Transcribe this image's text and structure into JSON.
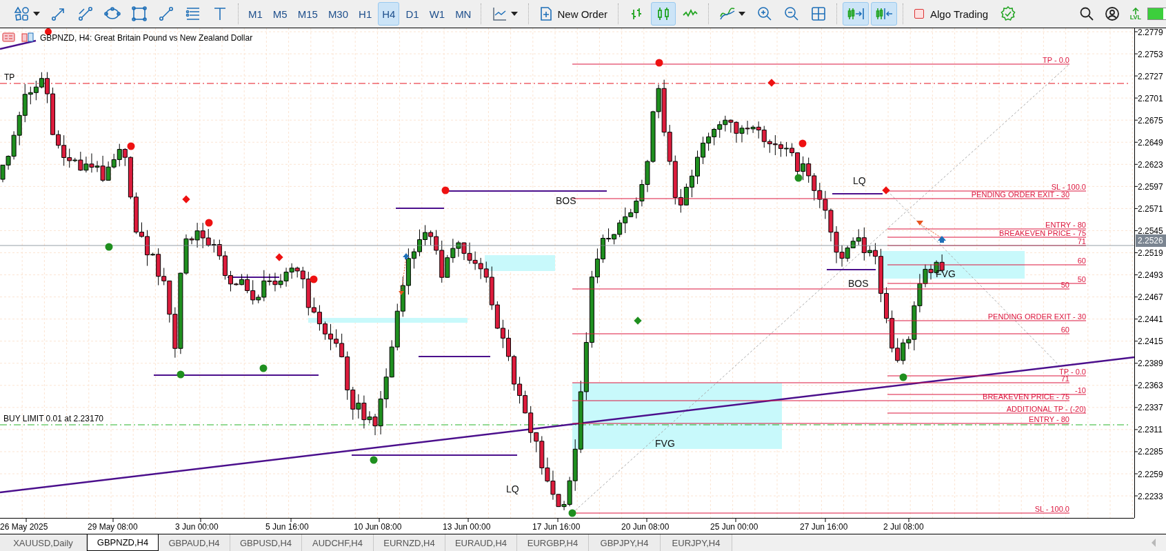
{
  "toolbar": {
    "tools": [
      {
        "kind": "shapes"
      },
      {
        "kind": "arrow"
      },
      {
        "kind": "segment"
      },
      {
        "kind": "ellipse"
      },
      {
        "kind": "rectangle"
      },
      {
        "kind": "line"
      },
      {
        "kind": "fibo"
      },
      {
        "kind": "text"
      }
    ],
    "timeframes": [
      {
        "label": "M1",
        "selected": false
      },
      {
        "label": "M5",
        "selected": false
      },
      {
        "label": "M15",
        "selected": false
      },
      {
        "label": "M30",
        "selected": false
      },
      {
        "label": "H1",
        "selected": false
      },
      {
        "label": "H4",
        "selected": true
      },
      {
        "label": "D1",
        "selected": false
      },
      {
        "label": "W1",
        "selected": false
      },
      {
        "label": "MN",
        "selected": false
      }
    ],
    "new_order": "New Order",
    "chart_styles": [
      {
        "kind": "bars",
        "selected": false
      },
      {
        "kind": "candles",
        "selected": true
      },
      {
        "kind": "line",
        "selected": false
      }
    ],
    "view_tools": [
      {
        "kind": "indicators"
      },
      {
        "kind": "zoom-in"
      },
      {
        "kind": "zoom-out"
      },
      {
        "kind": "tile"
      }
    ],
    "scroll_tools": [
      {
        "kind": "autoscroll",
        "selected": true
      },
      {
        "kind": "shift",
        "selected": true
      }
    ],
    "algo_trading": {
      "label": "Algo Trading",
      "on": false
    },
    "level_label": "LVL"
  },
  "chart": {
    "title": "GBPNZD, H4:  Great Britain Pound vs New Zealand Dollar",
    "price_ticks": [
      "2.2779",
      "2.2753",
      "2.2727",
      "2.2701",
      "2.2675",
      "2.2649",
      "2.2623",
      "2.2597",
      "2.2571",
      "2.2545",
      "2.2519",
      "2.2493",
      "2.2467",
      "2.2441",
      "2.2415",
      "2.2389",
      "2.2363",
      "2.2337",
      "2.2311",
      "2.2285",
      "2.2259",
      "2.2233"
    ],
    "current_price": "2.2526",
    "time_ticks": [
      "26 May 2025",
      "29 May 08:00",
      "3 Jun 00:00",
      "5 Jun 16:00",
      "10 Jun 08:00",
      "13 Jun 00:00",
      "17 Jun 16:00",
      "20 Jun 08:00",
      "25 Jun 00:00",
      "27 Jun 16:00",
      "2 Jul 08:00"
    ],
    "order_lines": [
      {
        "kind": "tp",
        "label": "TP"
      },
      {
        "kind": "buy-limit",
        "label": "BUY LIMIT 0.01 at 2.23170"
      }
    ],
    "fib_levels": [
      {
        "label": "TP - 0.0"
      },
      {
        "label": "SL - 100.0"
      },
      {
        "label": "PENDING ORDER EXIT - 30"
      },
      {
        "label": "ENTRY - 80"
      },
      {
        "label": "BREAKEVEN PRICE - 75"
      },
      {
        "label": "71"
      },
      {
        "label": "60"
      },
      {
        "label": "50"
      },
      {
        "label": "50"
      },
      {
        "label": "PENDING ORDER EXIT - 30"
      },
      {
        "label": "60"
      },
      {
        "label": "TP - 0.0"
      },
      {
        "label": "71"
      },
      {
        "label": "-10"
      },
      {
        "label": "BREAKEVEN PRICE - 75"
      },
      {
        "label": "ADDITIONAL TP - (-20)"
      },
      {
        "label": "ENTRY - 80"
      },
      {
        "label": "SL - 100.0"
      }
    ],
    "annotations": [
      {
        "label": "BOS"
      },
      {
        "label": "LQ"
      },
      {
        "label": "BOS"
      },
      {
        "label": "FVG"
      },
      {
        "label": "FVG"
      },
      {
        "label": "LQ"
      }
    ]
  },
  "tabs": [
    {
      "label": "XAUUSD,Daily",
      "selected": false
    },
    {
      "label": "GBPNZD,H4",
      "selected": true
    },
    {
      "label": "GBPAUD,H4",
      "selected": false
    },
    {
      "label": "GBPUSD,H4",
      "selected": false
    },
    {
      "label": "AUDCHF,H4",
      "selected": false
    },
    {
      "label": "EURNZD,H4",
      "selected": false
    },
    {
      "label": "EURAUD,H4",
      "selected": false
    },
    {
      "label": "EURGBP,H4",
      "selected": false
    },
    {
      "label": "GBPJPY,H4",
      "selected": false
    },
    {
      "label": "EURJPY,H4",
      "selected": false
    }
  ]
}
